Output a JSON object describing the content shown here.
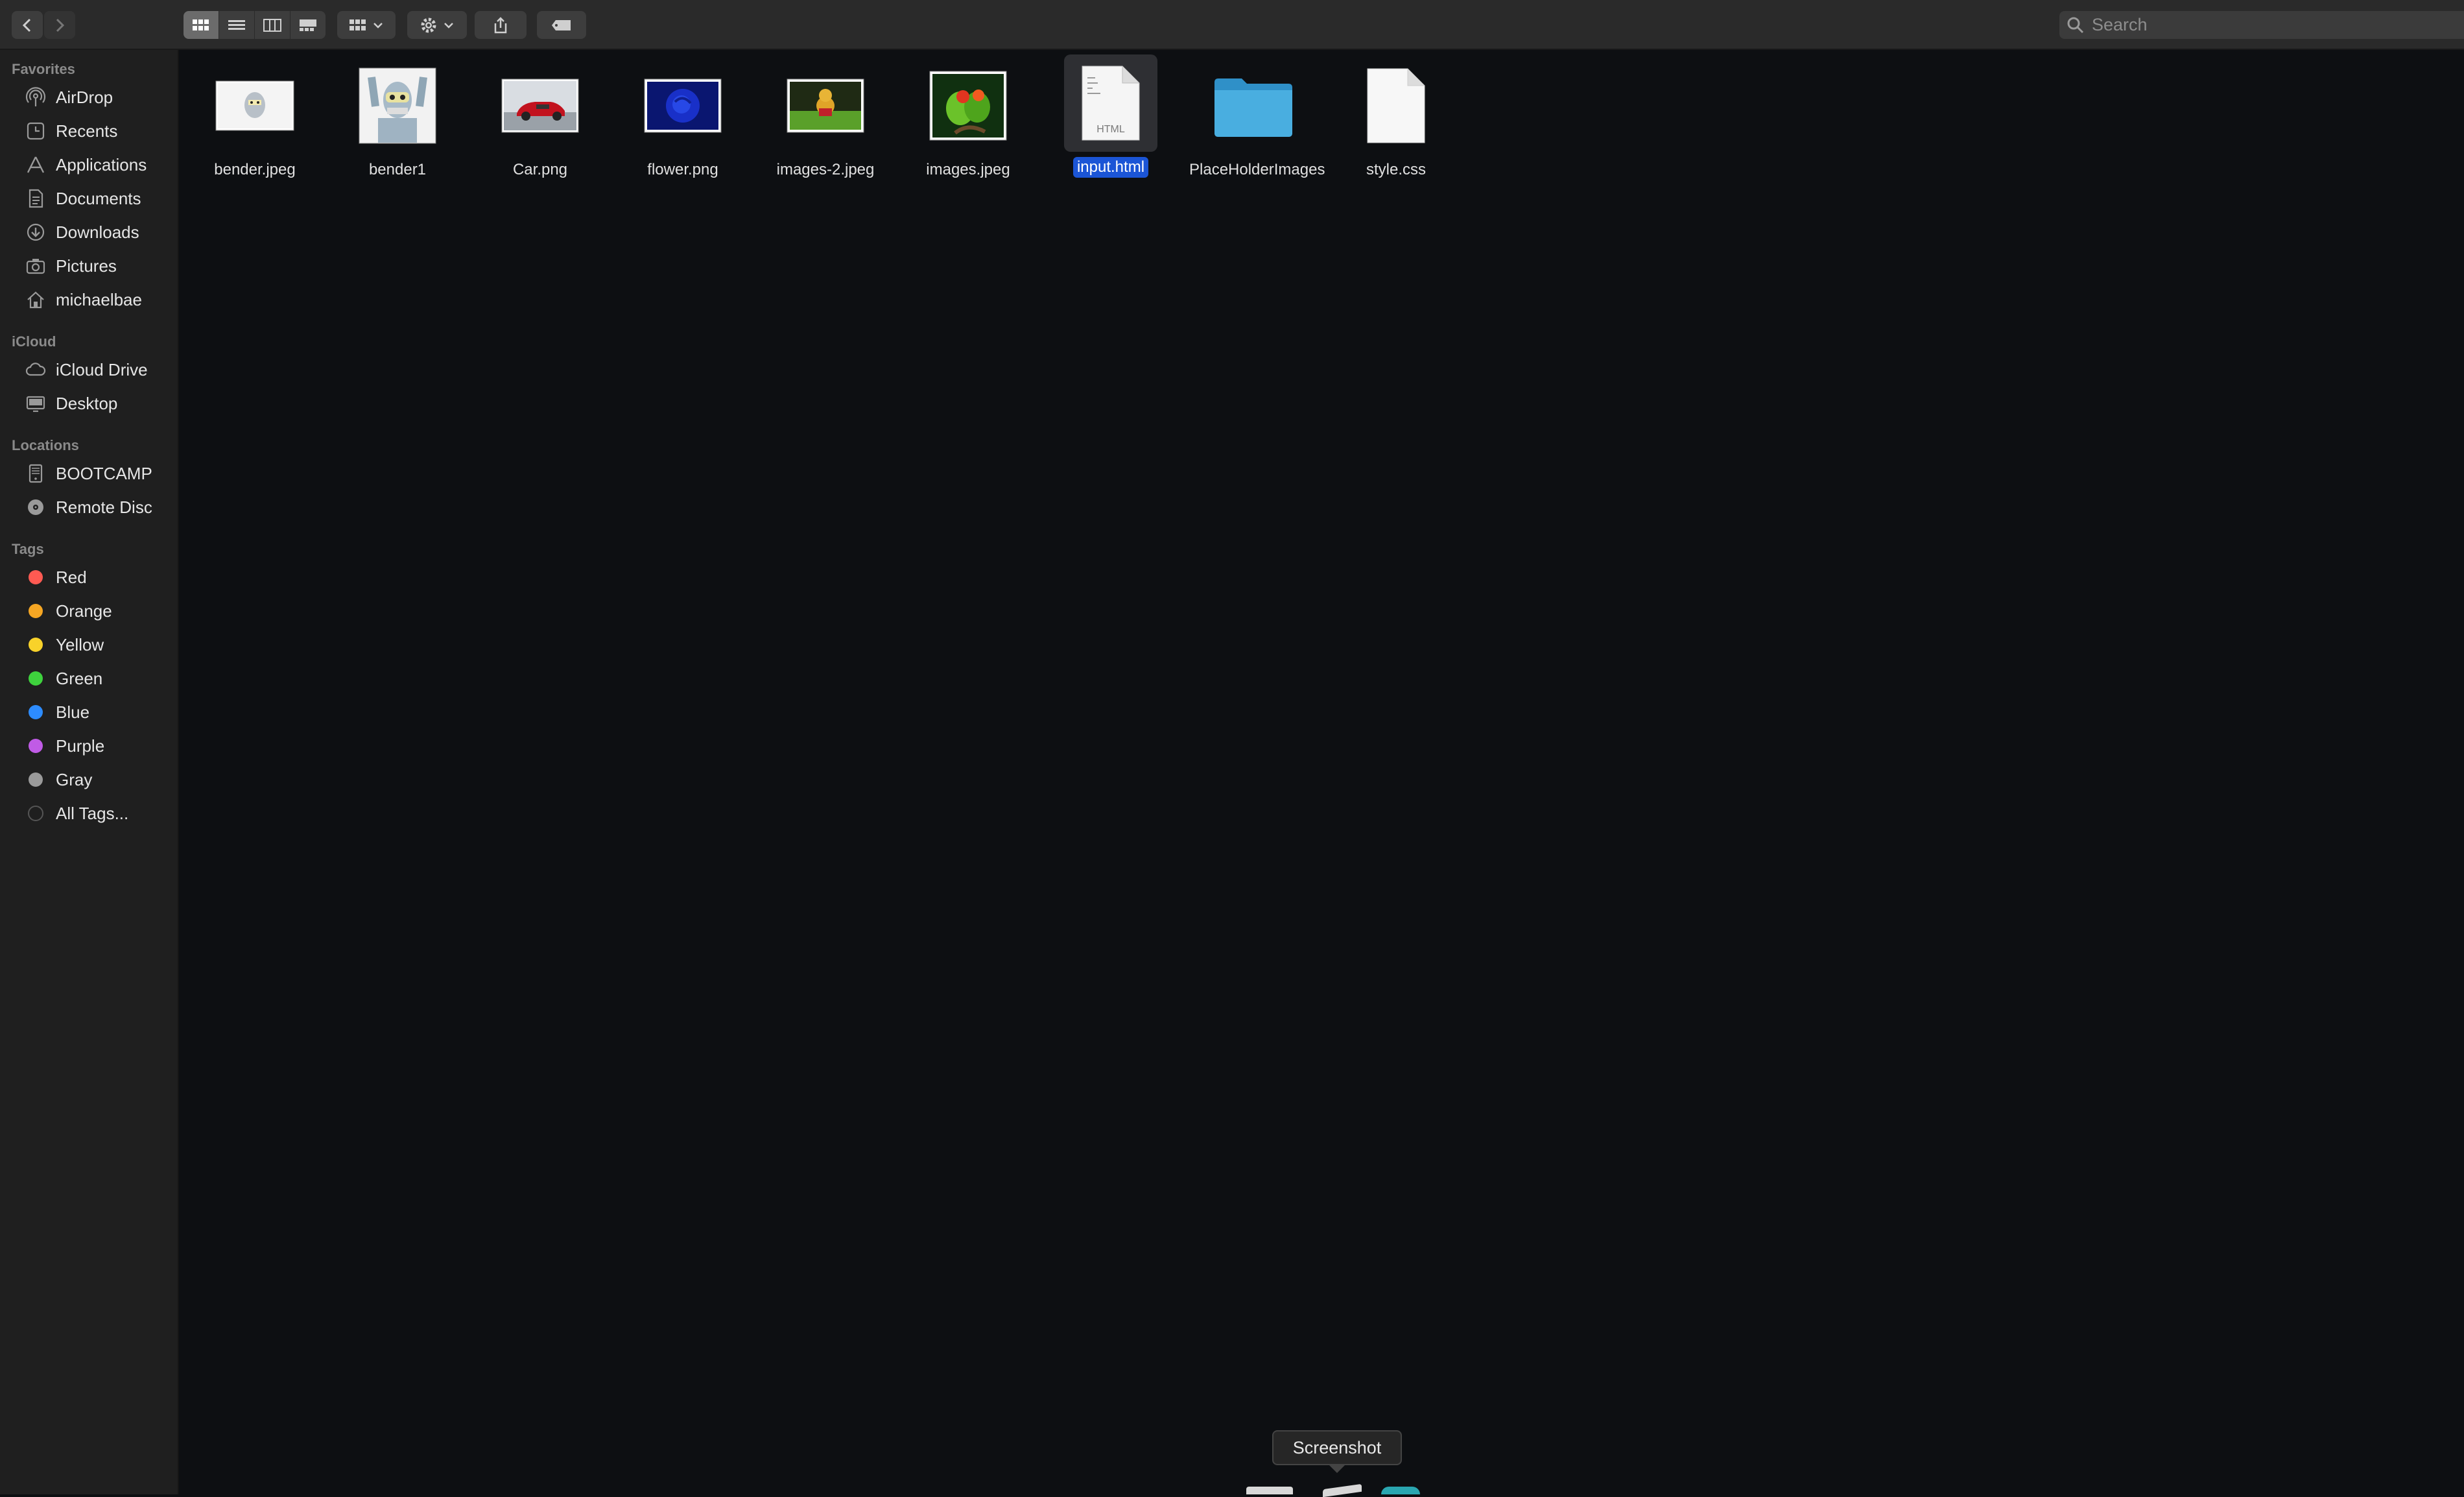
{
  "toolbar": {
    "back_icon": "chevron-left-icon",
    "forward_icon": "chevron-right-icon",
    "view_modes": [
      "icon-view",
      "list-view",
      "column-view",
      "gallery-view"
    ],
    "search_placeholder": "Search"
  },
  "sidebar": {
    "favorites_header": "Favorites",
    "favorites": [
      {
        "label": "AirDrop",
        "icon": "airdrop-icon"
      },
      {
        "label": "Recents",
        "icon": "clock-icon"
      },
      {
        "label": "Applications",
        "icon": "applications-icon"
      },
      {
        "label": "Documents",
        "icon": "document-icon"
      },
      {
        "label": "Downloads",
        "icon": "download-icon"
      },
      {
        "label": "Pictures",
        "icon": "camera-icon"
      },
      {
        "label": "michaelbae",
        "icon": "home-icon"
      }
    ],
    "icloud_header": "iCloud",
    "icloud": [
      {
        "label": "iCloud Drive",
        "icon": "cloud-icon"
      },
      {
        "label": "Desktop",
        "icon": "desktop-icon"
      }
    ],
    "locations_header": "Locations",
    "locations": [
      {
        "label": "BOOTCAMP",
        "icon": "drive-icon"
      },
      {
        "label": "Remote Disc",
        "icon": "disc-icon"
      }
    ],
    "tags_header": "Tags",
    "tags": [
      {
        "label": "Red",
        "color": "#ff5a52"
      },
      {
        "label": "Orange",
        "color": "#f5a623"
      },
      {
        "label": "Yellow",
        "color": "#f8d22a"
      },
      {
        "label": "Green",
        "color": "#3ed23d"
      },
      {
        "label": "Blue",
        "color": "#2d8cff"
      },
      {
        "label": "Purple",
        "color": "#c05be6"
      },
      {
        "label": "Gray",
        "color": "#9a9a9a"
      },
      {
        "label": "All Tags...",
        "color": "none"
      }
    ]
  },
  "files": [
    {
      "name": "bender.jpeg",
      "icon": "image-thumbnail-icon"
    },
    {
      "name": "bender1",
      "icon": "image-thumbnail-icon"
    },
    {
      "name": "Car.png",
      "icon": "image-thumbnail-icon"
    },
    {
      "name": "flower.png",
      "icon": "image-thumbnail-icon"
    },
    {
      "name": "images-2.jpeg",
      "icon": "image-thumbnail-icon"
    },
    {
      "name": "images.jpeg",
      "icon": "image-thumbnail-icon"
    },
    {
      "name": "input.html",
      "icon": "html-file-icon",
      "badge": "HTML",
      "selected": true
    },
    {
      "name": "PlaceHolderImages",
      "icon": "folder-icon"
    },
    {
      "name": "style.css",
      "icon": "document-icon"
    }
  ],
  "tooltip": "Screenshot"
}
